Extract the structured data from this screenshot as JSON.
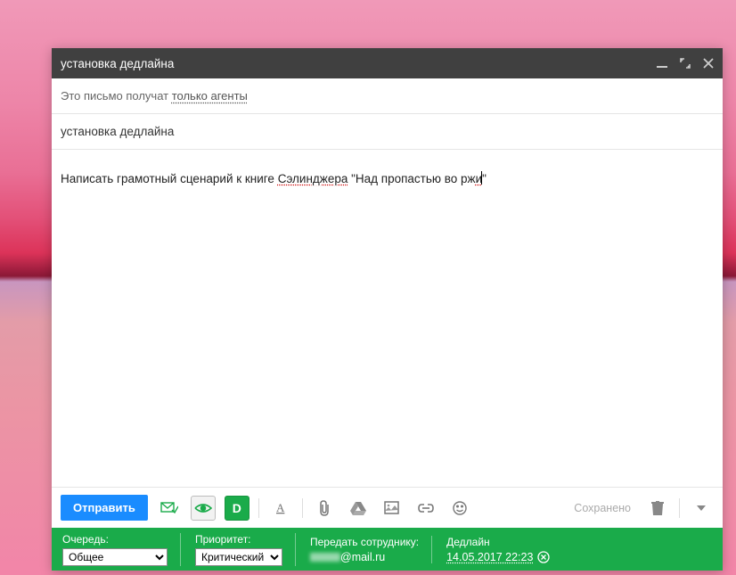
{
  "window": {
    "title": "установка дедлайна"
  },
  "recipients": {
    "prefix": "Это письмо получат ",
    "link": "только агенты"
  },
  "subject": "установка дедлайна",
  "body": {
    "part1": "Написать грамотный сценарий к книге ",
    "spell1": "Сэлинджера",
    "part2": " \"Над пропастью во рж",
    "part3": "и",
    "part4": "\""
  },
  "toolbar": {
    "send": "Отправить",
    "saved": "Сохранено",
    "d_label": "D"
  },
  "bottom": {
    "queue_label": "Очередь:",
    "queue_value": "Общее",
    "priority_label": "Приоритет:",
    "priority_value": "Критический",
    "transfer_label": "Передать сотруднику:",
    "transfer_value_suffix": "@mail.ru",
    "deadline_label": "Дедлайн",
    "deadline_value": "14.05.2017 22:23"
  }
}
